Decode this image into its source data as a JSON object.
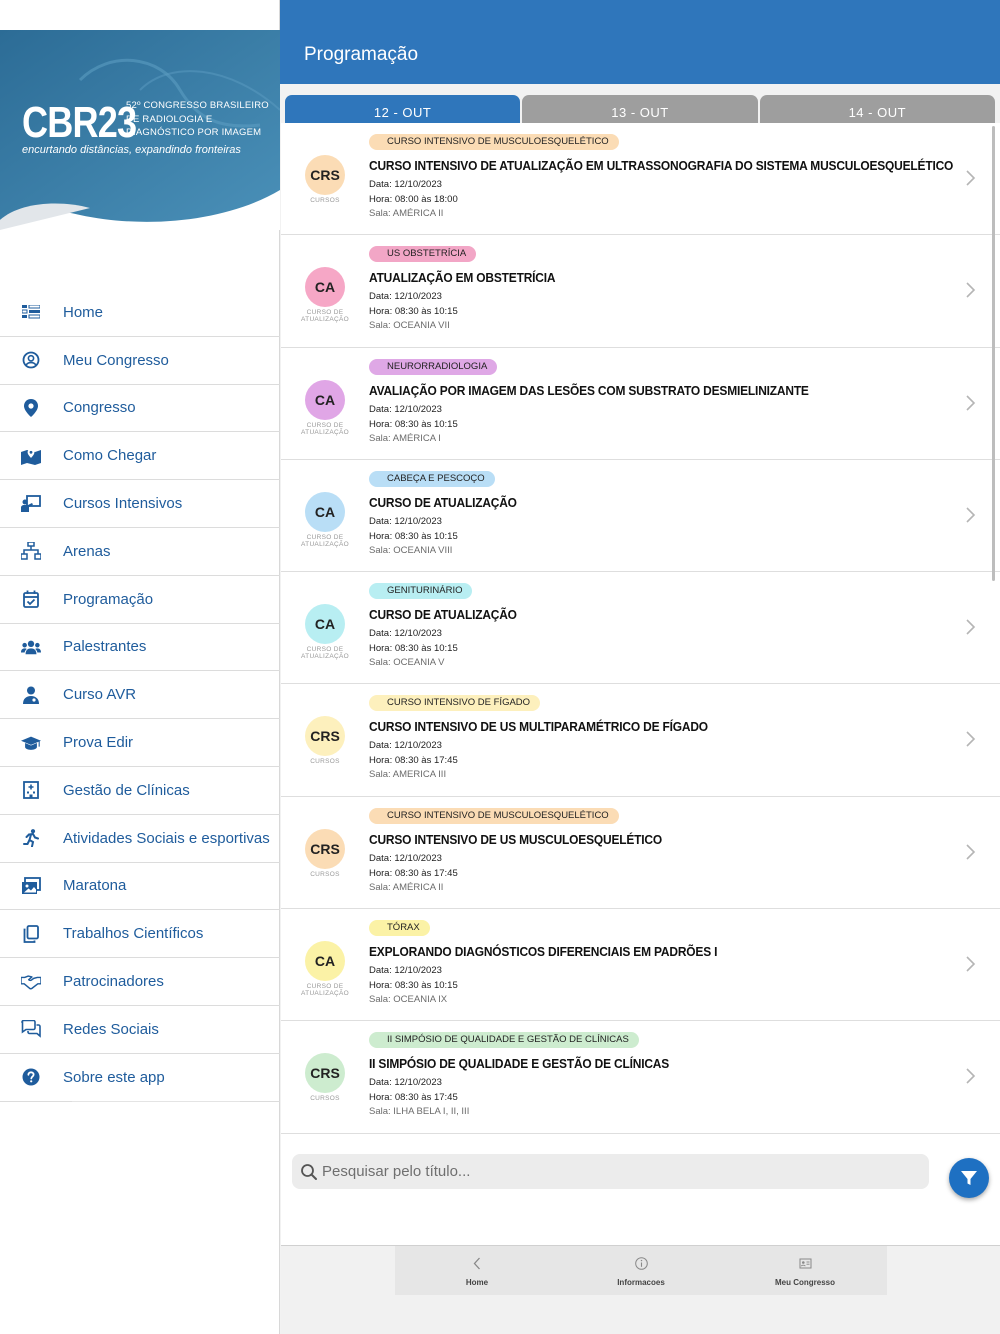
{
  "colors": {
    "primary": "#2f76bb",
    "nav_text": "#1f5c9c",
    "header_dark": "#2e6f98",
    "header_light": "#3f8ab3"
  },
  "logo": {
    "main": "CBR23",
    "subtitle_lines": [
      "52º CONGRESSO BRASILEIRO",
      "DE RADIOLOGIA E",
      "DIAGNÓSTICO POR IMAGEM"
    ],
    "tagline": "encurtando distâncias, expandindo fronteiras"
  },
  "nav": [
    {
      "label": "Home",
      "icon": "home-icon"
    },
    {
      "label": "Meu Congresso",
      "icon": "user-circle-icon"
    },
    {
      "label": "Congresso",
      "icon": "location-pin-icon"
    },
    {
      "label": "Como Chegar",
      "icon": "map-pin-icon"
    },
    {
      "label": "Cursos Intensivos",
      "icon": "teacher-board-icon"
    },
    {
      "label": "Arenas",
      "icon": "sitemap-icon"
    },
    {
      "label": "Programação",
      "icon": "calendar-check-icon"
    },
    {
      "label": "Palestrantes",
      "icon": "users-icon"
    },
    {
      "label": "Curso AVR",
      "icon": "user-doctor-icon"
    },
    {
      "label": "Prova Edir",
      "icon": "graduation-cap-icon"
    },
    {
      "label": "Gestão de Clínicas",
      "icon": "hospital-icon"
    },
    {
      "label": "Atividades Sociais e esportivas",
      "icon": "running-icon"
    },
    {
      "label": "Maratona",
      "icon": "photo-gallery-icon"
    },
    {
      "label": "Trabalhos Científicos",
      "icon": "copy-documents-icon"
    },
    {
      "label": "Patrocinadores",
      "icon": "handshake-icon"
    },
    {
      "label": "Redes Sociais",
      "icon": "chat-bubbles-icon"
    },
    {
      "label": "Sobre este app",
      "icon": "question-circle-icon"
    }
  ],
  "header": {
    "title": "Programação"
  },
  "tabs": [
    {
      "label": "12 - OUT",
      "active": true
    },
    {
      "label": "13 - OUT",
      "active": false
    },
    {
      "label": "14 - OUT",
      "active": false
    }
  ],
  "events": [
    {
      "badge": "CRS",
      "badge_caption": "CURSOS",
      "badge_color": "#fbdcb5",
      "tag": "CURSO INTENSIVO DE MUSCULOESQUELÉTICO",
      "tag_color": "#fbdcb5",
      "title": "CURSO INTENSIVO DE ATUALIZAÇÃO EM ULTRASSONOGRAFIA DO SISTEMA MUSCULOESQUELÉTICO",
      "date": "Data: 12/10/2023",
      "time": "Hora: 08:00 às 18:00",
      "room": "Sala: AMÉRICA II"
    },
    {
      "badge": "CA",
      "badge_caption": "CURSO DE ATUALIZAÇÃO",
      "badge_color": "#f6a7c6",
      "tag": "US OBSTETRÍCIA",
      "tag_color": "#f2a6c6",
      "title": "ATUALIZAÇÃO EM OBSTETRÍCIA",
      "date": "Data: 12/10/2023",
      "time": "Hora: 08:30 às 10:15",
      "room": "Sala: OCEANIA VII"
    },
    {
      "badge": "CA",
      "badge_caption": "CURSO DE ATUALIZAÇÃO",
      "badge_color": "#e0a6e6",
      "tag": "NEURORRADIOLOGIA",
      "tag_color": "#dfa8e6",
      "title": "AVALIAÇÃO POR IMAGEM DAS LESÕES COM SUBSTRATO DESMIELINIZANTE",
      "date": "Data: 12/10/2023",
      "time": "Hora: 08:30 às 10:15",
      "room": "Sala: AMÉRICA I"
    },
    {
      "badge": "CA",
      "badge_caption": "CURSO DE ATUALIZAÇÃO",
      "badge_color": "#b9def6",
      "tag": "CABEÇA E PESCOÇO",
      "tag_color": "#b9def6",
      "title": "CURSO DE ATUALIZAÇÃO",
      "date": "Data: 12/10/2023",
      "time": "Hora: 08:30 às 10:15",
      "room": "Sala: OCEANIA VIII"
    },
    {
      "badge": "CA",
      "badge_caption": "CURSO DE ATUALIZAÇÃO",
      "badge_color": "#b8eef2",
      "tag": "GENITURINÁRIO",
      "tag_color": "#b8eef2",
      "title": "CURSO DE ATUALIZAÇÃO",
      "date": "Data: 12/10/2023",
      "time": "Hora: 08:30 às 10:15",
      "room": "Sala: OCEANIA V"
    },
    {
      "badge": "CRS",
      "badge_caption": "CURSOS",
      "badge_color": "#fdf0bd",
      "tag": "CURSO INTENSIVO DE FÍGADO",
      "tag_color": "#fdf0bd",
      "title": "CURSO INTENSIVO DE US MULTIPARAMÉTRICO DE FÍGADO",
      "date": "Data: 12/10/2023",
      "time": "Hora: 08:30 às 17:45",
      "room": "Sala: AMERICA III"
    },
    {
      "badge": "CRS",
      "badge_caption": "CURSOS",
      "badge_color": "#fbdcb5",
      "tag": "CURSO INTENSIVO DE MUSCULOESQUELÉTICO",
      "tag_color": "#fbdcb5",
      "title": "CURSO INTENSIVO DE US MUSCULOESQUELÉTICO",
      "date": "Data: 12/10/2023",
      "time": "Hora: 08:30 às 17:45",
      "room": "Sala: AMÉRICA II"
    },
    {
      "badge": "CA",
      "badge_caption": "CURSO DE ATUALIZAÇÃO",
      "badge_color": "#fbf2a6",
      "tag": "TÓRAX",
      "tag_color": "#fbf2a6",
      "title": "EXPLORANDO DIAGNÓSTICOS DIFERENCIAIS EM PADRÕES I",
      "date": "Data: 12/10/2023",
      "time": "Hora: 08:30 às 10:15",
      "room": "Sala: OCEANIA IX"
    },
    {
      "badge": "CRS",
      "badge_caption": "CURSOS",
      "badge_color": "#cdeccf",
      "tag": "II SIMPÓSIO DE QUALIDADE E GESTÃO DE CLÍNICAS",
      "tag_color": "#cdeccf",
      "title": "II SIMPÓSIO DE QUALIDADE E GESTÃO DE CLÍNICAS",
      "date": "Data: 12/10/2023",
      "time": "Hora: 08:30 às 17:45",
      "room": "Sala: ILHA BELA I, II, III"
    }
  ],
  "search": {
    "placeholder": "Pesquisar pelo título..."
  },
  "bottom_tabs": [
    {
      "label": "Home",
      "icon": "chevron-left-icon"
    },
    {
      "label": "Informacoes",
      "icon": "info-icon"
    },
    {
      "label": "Meu Congresso",
      "icon": "badge-card-icon"
    }
  ]
}
